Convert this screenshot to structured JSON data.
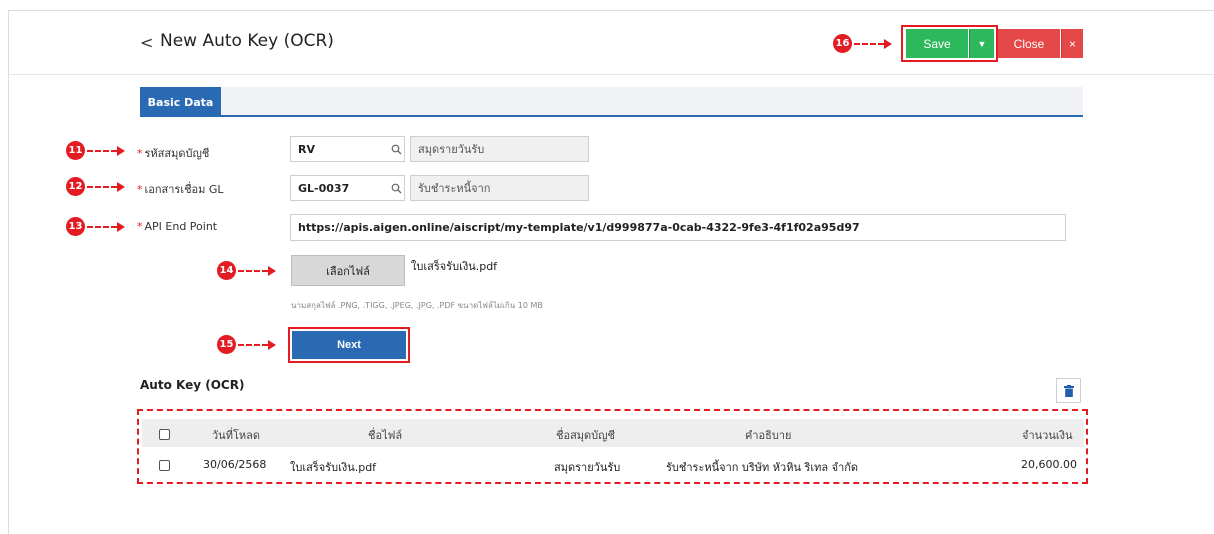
{
  "header": {
    "back_glyph": "<",
    "title": "New Auto Key (OCR)",
    "save_label": "Save",
    "save_dropdown_glyph": "▼",
    "close_label": "Close",
    "close_x_glyph": "×"
  },
  "callouts": {
    "c11": "11",
    "c12": "12",
    "c13": "13",
    "c14": "14",
    "c15": "15",
    "c16": "16"
  },
  "tabs": [
    {
      "label": "Basic Data",
      "active": true
    }
  ],
  "form": {
    "journal_code": {
      "required_mark": "*",
      "label": "รหัสสมุดบัญชี",
      "value": "RV",
      "description": "สมุดรายวันรับ",
      "search_icon": "search-icon"
    },
    "gl_link": {
      "required_mark": "*",
      "label": "เอกสารเชื่อม GL",
      "value": "GL-0037",
      "description": "รับชำระหนี้จาก",
      "search_icon": "search-icon"
    },
    "api_endpoint": {
      "required_mark": "*",
      "label": "API End Point",
      "value": "https://apis.aigen.online/aiscript/my-template/v1/d999877a-0cab-4322-9fe3-4f1f02a95d97"
    },
    "file": {
      "button_label": "เลือกไฟล์",
      "selected_file": "ใบเสร็จรับเงิน.pdf",
      "hint": "นามสกุลไฟล์ .PNG, .TIGG, .JPEG, .JPG, .PDF ขนาดไฟล์ไม่เกิน 10 MB"
    },
    "next_label": "Next"
  },
  "auto_key": {
    "title": "Auto Key (OCR)",
    "delete_icon": "trash-icon",
    "columns": [
      "วันที่โหลด",
      "ชื่อไฟล์",
      "ชื่อสมุดบัญชี",
      "คำอธิบาย",
      "จำนวนเงิน"
    ],
    "rows": [
      {
        "checked": false,
        "date": "30/06/2568",
        "file_name": "ใบเสร็จรับเงิน.pdf",
        "journal_name": "สมุดรายวันรับ",
        "description": "รับชำระหนี้จาก บริษัท หัวหิน ริเทล จำกัด",
        "amount": "20,600.00"
      }
    ]
  },
  "colors": {
    "accent_red": "#e31b23",
    "save_green": "#2eb85c",
    "close_red": "#e54848",
    "primary_blue": "#2a6ab3"
  }
}
